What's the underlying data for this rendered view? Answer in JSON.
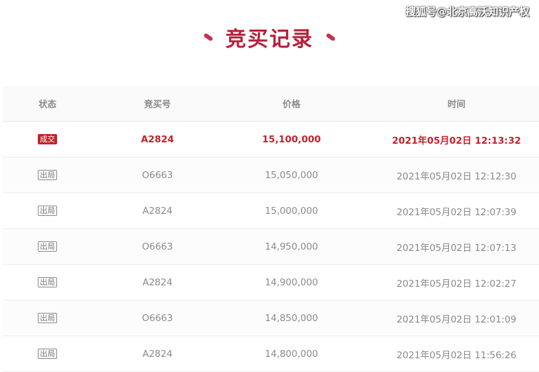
{
  "watermark": "搜狐号@北京高沃知识产权",
  "title": "竞买记录",
  "headers": {
    "status": "状态",
    "bid_no": "竞买号",
    "price": "价格",
    "time": "时间"
  },
  "rows": [
    {
      "status": "成交",
      "bid_no": "A2824",
      "price": "15,100,000",
      "time": "2021年05月02日 12:13:32"
    },
    {
      "status": "出局",
      "bid_no": "O6663",
      "price": "15,050,000",
      "time": "2021年05月02日 12:12:30"
    },
    {
      "status": "出局",
      "bid_no": "A2824",
      "price": "15,000,000",
      "time": "2021年05月02日 12:07:39"
    },
    {
      "status": "出局",
      "bid_no": "O6663",
      "price": "14,950,000",
      "time": "2021年05月02日 12:07:13"
    },
    {
      "status": "出局",
      "bid_no": "A2824",
      "price": "14,900,000",
      "time": "2021年05月02日 12:02:27"
    },
    {
      "status": "出局",
      "bid_no": "O6663",
      "price": "14,850,000",
      "time": "2021年05月02日 12:01:09"
    },
    {
      "status": "出局",
      "bid_no": "A2824",
      "price": "14,800,000",
      "time": "2021年05月02日 11:56:26"
    }
  ],
  "colors": {
    "accent": "#c0232b",
    "title": "#b5203a",
    "muted": "#8a8a8a"
  }
}
